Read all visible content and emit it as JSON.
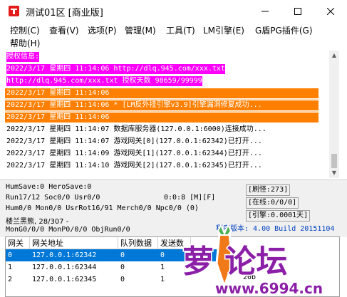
{
  "window": {
    "title": "测试01区 [商业版]",
    "accent": "#ff00ff"
  },
  "menu": {
    "items": [
      {
        "label": "控制(C)"
      },
      {
        "label": "查看(V)"
      },
      {
        "label": "选项(P)"
      },
      {
        "label": "管理(M)"
      },
      {
        "label": "工具(T)"
      },
      {
        "label": "LM引擎(E)"
      },
      {
        "label": "G盾PG插件(G)"
      },
      {
        "label": "帮助(H)"
      }
    ]
  },
  "log": {
    "lines": [
      {
        "text": "授权信息:",
        "style": "magenta"
      },
      {
        "text": "2022/3/17 星期四 11:14:06 http://dlq.945.com/xxx.txt",
        "style": "magenta"
      },
      {
        "text": "http://dlq.945.com/xxx.txt 授权天数 98659/99999",
        "style": "magenta"
      },
      {
        "text": "2022/3/17 星期四 11:14:06",
        "style": "orange"
      },
      {
        "text": "2022/3/17 星期四 11:14:06 * [LM反外挂引擎v3.9]引擎漏洞修复成功...",
        "style": "orange"
      },
      {
        "text": "2022/3/17 星期四 11:14:06",
        "style": "orange"
      },
      {
        "text": "2022/3/17 星期四 11:14:07 数据库服务器(127.0.0.1:6000)连接成功...",
        "style": "plain"
      },
      {
        "text": "2022/3/17 星期四 11:14:07 游戏网关[0](127.0.0.1:62342)已打开...",
        "style": "plain"
      },
      {
        "text": "2022/3/17 星期四 11:14:09 游戏网关[1](127.0.0.1:62344)已打开...",
        "style": "plain"
      },
      {
        "text": "2022/3/17 星期四 11:14:10 游戏网关[2](127.0.0.1:62345)已打开...",
        "style": "plain"
      }
    ]
  },
  "status": {
    "line1": "HumSave:0 HeroSave:0",
    "line2": "Run17/12 Soc0/0 Usr0/0",
    "line2_right": "0:0:8 [M][F]",
    "line3": "Hum0/0 Mon0/0 UsrRot16/91 Merch0/0 Npc0/0 (0)",
    "line4": "楼兰黑熊, 28/307 -",
    "line5": "MonG0/0/0 MonP0/0/0 ObjRun0/0",
    "refresh": "[刷怪:273]",
    "online": "[在线:0/0/0]",
    "engine": "[引擎:0.0001天]",
    "version": "程序版本: 4.00 Build 20151104"
  },
  "table": {
    "headers": [
      "网关",
      "网关地址",
      "队列数据",
      "发送数"
    ],
    "rows": [
      {
        "gate": "0",
        "address": "127.0.0.1:62342",
        "queue": "0",
        "sent": "0",
        "selected": true
      },
      {
        "gate": "1",
        "address": "127.0.0.1:62344",
        "queue": "0",
        "sent": "1",
        "selected": false
      },
      {
        "gate": "2",
        "address": "127.0.0.1:62345",
        "queue": "0",
        "sent": "1",
        "selected": false
      }
    ],
    "extra_cell": "20b"
  },
  "watermark": {
    "text": "萝卜论坛",
    "url": "www.6994.cn"
  }
}
